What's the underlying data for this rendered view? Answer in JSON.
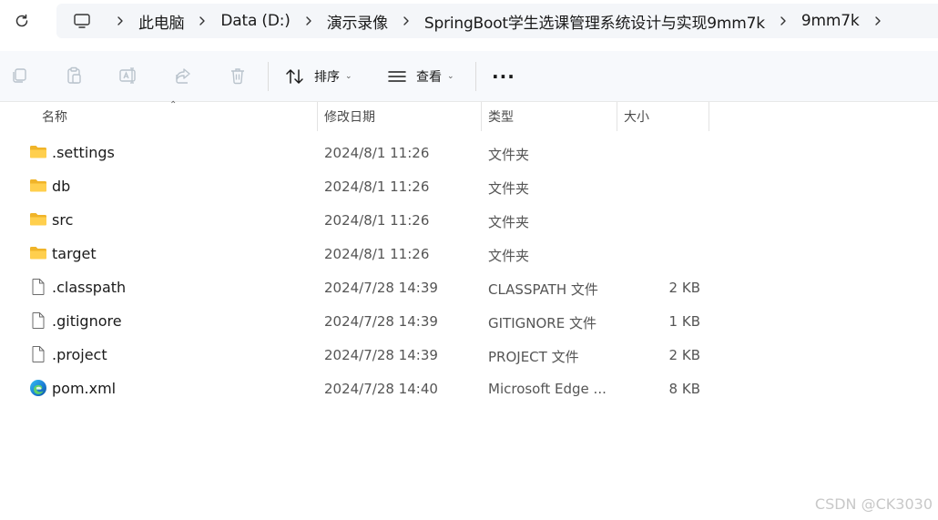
{
  "address_bar": {
    "icon": "computer-icon",
    "crumbs": [
      "此电脑",
      "Data (D:)",
      "演示录像",
      "SpringBoot学生选课管理系统设计与实现9mm7k",
      "9mm7k"
    ]
  },
  "toolbar": {
    "icons": [
      "copy-icon",
      "paste-icon",
      "rename-icon",
      "share-icon",
      "delete-icon"
    ],
    "sort_label": "排序",
    "view_label": "查看",
    "more_label": "···"
  },
  "columns": {
    "name": "名称",
    "date": "修改日期",
    "type": "类型",
    "size": "大小"
  },
  "files": [
    {
      "name": ".settings",
      "date": "2024/8/1 11:26",
      "type": "文件夹",
      "size": "",
      "icon": "folder-icon"
    },
    {
      "name": "db",
      "date": "2024/8/1 11:26",
      "type": "文件夹",
      "size": "",
      "icon": "folder-icon"
    },
    {
      "name": "src",
      "date": "2024/8/1 11:26",
      "type": "文件夹",
      "size": "",
      "icon": "folder-icon"
    },
    {
      "name": "target",
      "date": "2024/8/1 11:26",
      "type": "文件夹",
      "size": "",
      "icon": "folder-icon"
    },
    {
      "name": ".classpath",
      "date": "2024/7/28 14:39",
      "type": "CLASSPATH 文件",
      "size": "2 KB",
      "icon": "file-icon"
    },
    {
      "name": ".gitignore",
      "date": "2024/7/28 14:39",
      "type": "GITIGNORE 文件",
      "size": "1 KB",
      "icon": "file-icon"
    },
    {
      "name": ".project",
      "date": "2024/7/28 14:39",
      "type": "PROJECT 文件",
      "size": "2 KB",
      "icon": "file-icon"
    },
    {
      "name": "pom.xml",
      "date": "2024/7/28 14:40",
      "type": "Microsoft Edge ...",
      "size": "8 KB",
      "icon": "edge-icon"
    }
  ],
  "watermark": "CSDN @CK3030",
  "colors": {
    "folder": "#f5c244",
    "accent": "#0a74d0"
  }
}
